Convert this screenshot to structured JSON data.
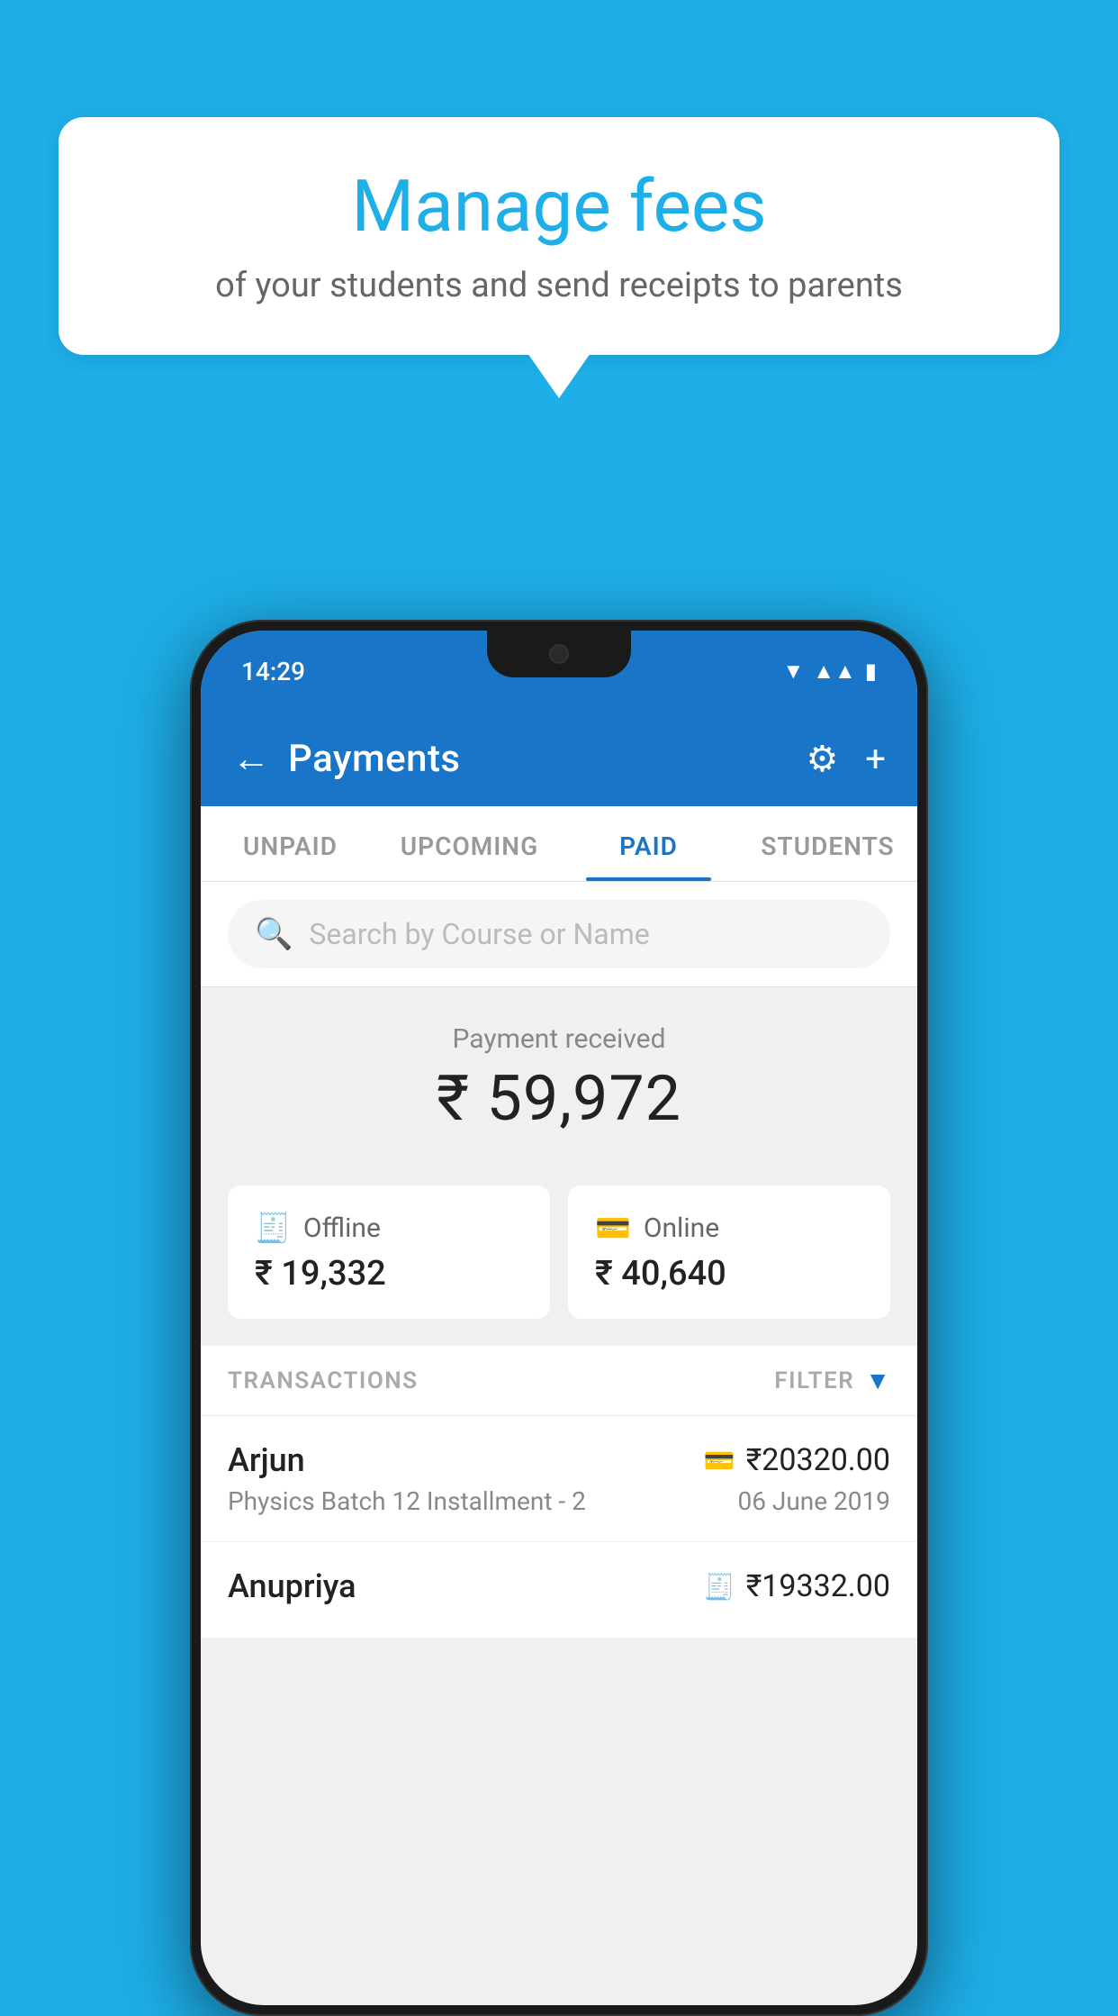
{
  "background_color": "#1EAEE8",
  "speech_bubble": {
    "title": "Manage fees",
    "subtitle": "of your students and send receipts to parents"
  },
  "phone": {
    "status_bar": {
      "time": "14:29"
    },
    "app_bar": {
      "title": "Payments",
      "back_icon": "←",
      "settings_icon": "⚙",
      "add_icon": "+"
    },
    "tabs": [
      {
        "label": "UNPAID",
        "active": false
      },
      {
        "label": "UPCOMING",
        "active": false
      },
      {
        "label": "PAID",
        "active": true
      },
      {
        "label": "STUDENTS",
        "active": false
      }
    ],
    "search": {
      "placeholder": "Search by Course or Name"
    },
    "payment_summary": {
      "label": "Payment received",
      "amount": "₹ 59,972"
    },
    "payment_cards": [
      {
        "icon": "💳",
        "type": "Offline",
        "amount": "₹ 19,332"
      },
      {
        "icon": "💳",
        "type": "Online",
        "amount": "₹ 40,640"
      }
    ],
    "transactions_section": {
      "label": "TRANSACTIONS",
      "filter_label": "FILTER"
    },
    "transactions": [
      {
        "name": "Arjun",
        "course": "Physics Batch 12 Installment - 2",
        "amount": "₹20320.00",
        "date": "06 June 2019",
        "payment_type_icon": "💳"
      },
      {
        "name": "Anupriya",
        "course": "",
        "amount": "₹19332.00",
        "date": "",
        "payment_type_icon": "💵"
      }
    ]
  }
}
